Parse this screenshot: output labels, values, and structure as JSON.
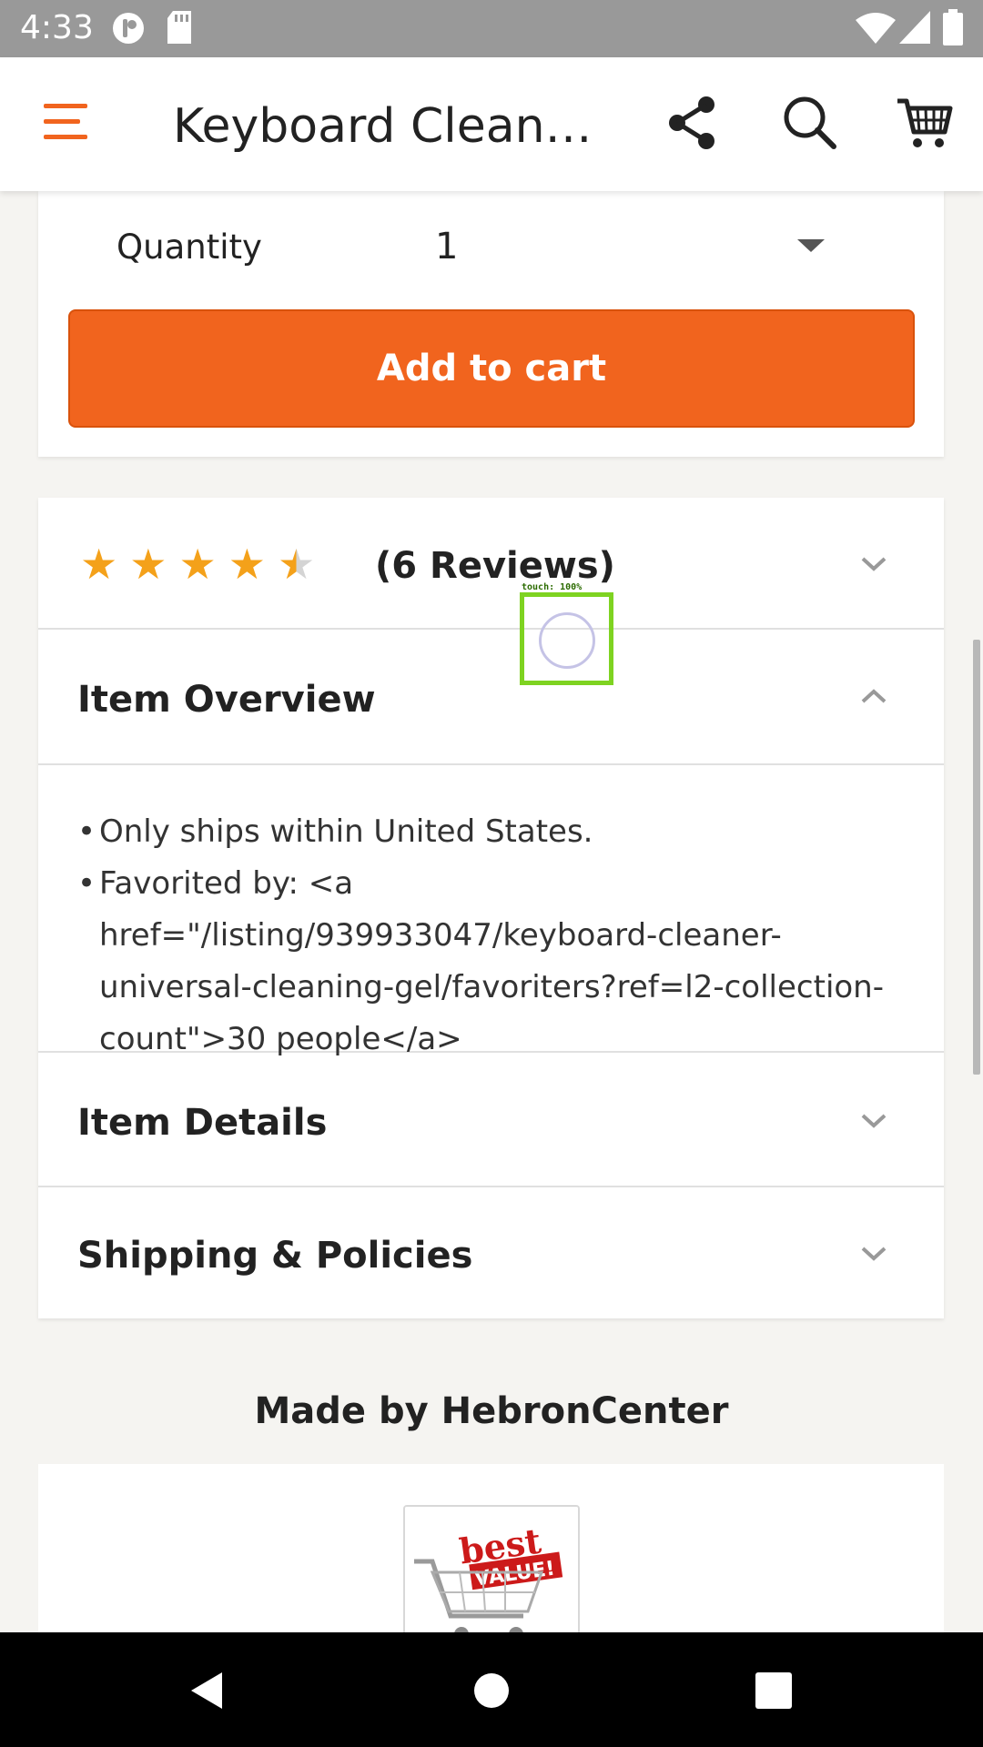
{
  "status_bar": {
    "time": "4:33",
    "left_icons": [
      "data-saver-icon",
      "sd-card-icon"
    ],
    "right_icons": [
      "wifi-icon",
      "signal-icon",
      "battery-icon"
    ]
  },
  "app_bar": {
    "title": "Keyboard Cleane…",
    "icons": [
      "menu-icon",
      "share-icon",
      "search-icon",
      "cart-icon"
    ],
    "accent_color": "#f1641e"
  },
  "quantity": {
    "label": "Quantity",
    "value": "1"
  },
  "add_to_cart": {
    "label": "Add to cart",
    "color": "#f1641e"
  },
  "reviews": {
    "rating": 4.5,
    "max_rating": 5,
    "count_text": "(6 Reviews)"
  },
  "sections": {
    "overview": {
      "title": "Item Overview",
      "expanded": true,
      "items": [
        "Only ships within United States.",
        "Favorited by: <a href=\"/listing/939933047/keyboard-cleaner-universal-cleaning-gel/favoriters?ref=l2-collection-count\">30 people</a>"
      ]
    },
    "details": {
      "title": "Item Details",
      "expanded": false
    },
    "shipping": {
      "title": "Shipping & Policies",
      "expanded": false
    }
  },
  "maker": {
    "text": "Made by HebronCenter",
    "logo_text": "best VALUE"
  },
  "touch_indicator": {
    "label": "touch: 100%"
  },
  "nav_bar": {
    "icons": [
      "back-icon",
      "home-icon",
      "recents-icon"
    ]
  }
}
